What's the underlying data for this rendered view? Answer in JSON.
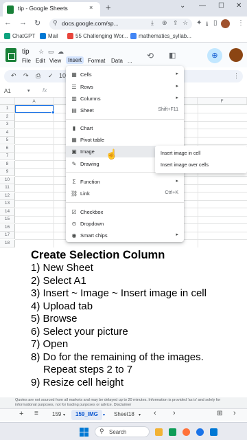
{
  "browser": {
    "tab_title": "tip - Google Sheets",
    "tab_close": "×",
    "new_tab": "+",
    "window_controls": [
      "⌄",
      "—",
      "☐",
      "✕"
    ],
    "url": "docs.google.com/sp...",
    "nav_icons": [
      "←",
      "→",
      "↻"
    ],
    "bookmarks": [
      {
        "label": "ChatGPT",
        "color": "#10a37f"
      },
      {
        "label": "Mail",
        "color": "#0078d4"
      },
      {
        "label": "55 Challenging Wor...",
        "color": "#e8453c"
      },
      {
        "label": "mathematics_syllab...",
        "color": "#4285f4"
      }
    ]
  },
  "sheets": {
    "doc_title": "tip",
    "menus": [
      "File",
      "Edit",
      "View",
      "Insert",
      "Format",
      "Data",
      "..."
    ],
    "name_box": "A1",
    "fx": "fx",
    "zoom": "10",
    "columns": [
      "A",
      "F"
    ],
    "rows": [
      "1",
      "2",
      "3",
      "4",
      "5",
      "6",
      "7",
      "8",
      "9",
      "10",
      "11",
      "12",
      "13",
      "14",
      "15",
      "16",
      "17",
      "18"
    ]
  },
  "insert_menu": {
    "items": [
      {
        "icon": "▦",
        "label": "Cells",
        "arrow": "▸"
      },
      {
        "icon": "☰",
        "label": "Rows",
        "arrow": "▸"
      },
      {
        "icon": "▥",
        "label": "Columns",
        "arrow": "▸"
      },
      {
        "icon": "▤",
        "label": "Sheet",
        "shortcut": "Shift+F11"
      },
      {
        "icon": "▮",
        "label": "Chart"
      },
      {
        "icon": "▦",
        "label": "Pivot table"
      },
      {
        "icon": "▣",
        "label": "Image",
        "arrow": "▸"
      },
      {
        "icon": "✎",
        "label": "Drawing"
      },
      {
        "icon": "Σ",
        "label": "Function",
        "arrow": "▸"
      },
      {
        "icon": "⛓",
        "label": "Link",
        "shortcut": "Ctrl+K"
      },
      {
        "icon": "☑",
        "label": "Checkbox"
      },
      {
        "icon": "⊙",
        "label": "Dropdown"
      },
      {
        "icon": "◉",
        "label": "Smart chips",
        "arrow": "▸"
      }
    ]
  },
  "image_submenu": {
    "items": [
      "Insert image in cell",
      "Insert image over cells"
    ]
  },
  "overlay": {
    "title": "Create Selection Column",
    "steps": [
      "1) New Sheet",
      "2) Select A1",
      "3) Insert ~ Image ~ Insert image in cell",
      "4) Upload tab",
      "5) Browse",
      "6) Select your picture",
      "7) Open",
      "8) Do for the remaining of the images.",
      "Repeat steps 2 to 7",
      "9) Resize cell height"
    ]
  },
  "disclaimer": "Quotes are not sourced from all markets and may be delayed up to 20 minutes. Information is provided 'as is' and solely for informational purposes, not for trading purposes or advice. Disclaimer",
  "sheet_tabs": {
    "add": "+",
    "all": "≡",
    "tabs": [
      "159",
      "159_IMG",
      "Sheet18"
    ],
    "active": "159_IMG",
    "nav": [
      "‹",
      "›"
    ]
  },
  "taskbar": {
    "search_label": "Search",
    "apps": [
      {
        "color": "#f2b233"
      },
      {
        "color": "#0f9d58"
      },
      {
        "color": "#ff7139"
      },
      {
        "color": "#1a73e8"
      },
      {
        "color": "#0078d4"
      }
    ]
  }
}
